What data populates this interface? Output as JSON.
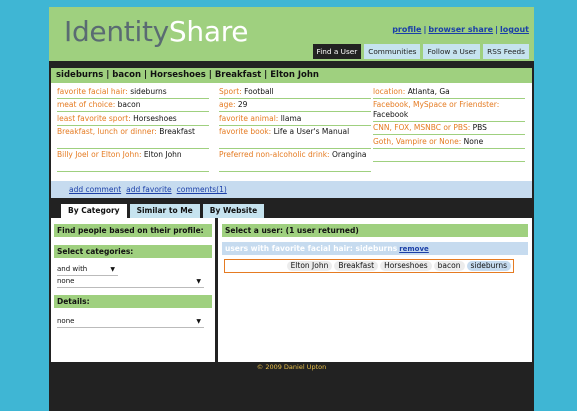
{
  "logo": {
    "part1": "Identity",
    "part2": "Share"
  },
  "top_links": {
    "profile": "profile",
    "browser_share": "browser share",
    "logout": "logout",
    "sep": "|"
  },
  "nav_tabs": [
    "Find a User",
    "Communities",
    "Follow a User",
    "RSS Feeds"
  ],
  "profile": {
    "title": "sideburns | bacon | Horseshoes | Breakfast | Elton John",
    "col1": [
      {
        "k": "favorite facial hair:",
        "v": "sideburns"
      },
      {
        "k": "meat of choice:",
        "v": "bacon"
      },
      {
        "k": "least favorite sport:",
        "v": "Horseshoes"
      },
      {
        "k": "Breakfast, lunch or dinner:",
        "v": "Breakfast"
      },
      {
        "k": "Billy Joel or Elton John:",
        "v": "Elton John"
      }
    ],
    "col2": [
      {
        "k": "Sport:",
        "v": "Football"
      },
      {
        "k": "age:",
        "v": "29"
      },
      {
        "k": "favorite animal:",
        "v": "llama"
      },
      {
        "k": "favorite book:",
        "v": "Life a User's Manual"
      },
      {
        "k": "Preferred non-alcoholic drink:",
        "v": "Orangina"
      }
    ],
    "col3": [
      {
        "k": "location:",
        "v": "Atlanta, Ga"
      },
      {
        "k": "Facebook, MySpace or Friendster:",
        "v": "Facebook"
      },
      {
        "k": "CNN, FOX, MSNBC or PBS:",
        "v": "PBS"
      },
      {
        "k": "Goth, Vampire or None:",
        "v": "None"
      }
    ],
    "actions": {
      "add_comment": "add comment",
      "add_favorite": "add favorite",
      "comments": "comments(1)"
    }
  },
  "search_tabs": [
    "By Category",
    "Similar to Me",
    "By Website"
  ],
  "left_panel": {
    "find_heading": "Find people based on their profile:",
    "categories_heading": "Select categories:",
    "andwith_value": "and with",
    "category_value": "none",
    "details_heading": "Details:",
    "details_value": "none"
  },
  "right_panel": {
    "heading": "Select a user: (1 user returned)",
    "filter_text": "users with favorite facial hair: sideburns",
    "remove_label": "remove",
    "chips": [
      "Elton John",
      "Breakfast",
      "Horseshoes",
      "bacon",
      "sideburns"
    ]
  },
  "footer": "© 2009 Daniel Upton",
  "colors": {
    "green": "#9fd07f",
    "dark": "#222222",
    "blue_frame": "#3fb6d4",
    "orange_label": "#e57b22",
    "light_blue": "#c6dbef"
  }
}
